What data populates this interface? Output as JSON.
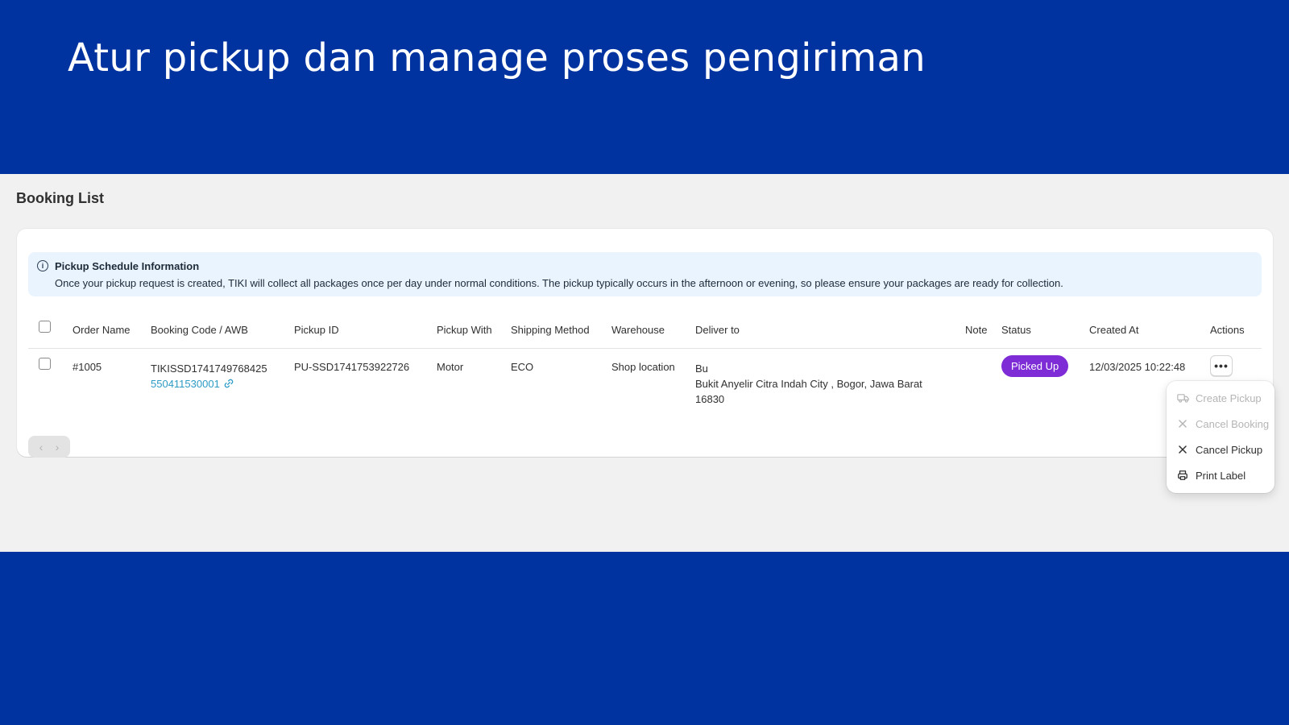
{
  "hero": {
    "title": "Atur pickup dan manage proses pengiriman"
  },
  "page": {
    "title": "Booking List"
  },
  "banner": {
    "icon": "info-icon",
    "title": "Pickup Schedule Information",
    "text": "Once your pickup request is created, TIKI will collect all packages once per day under normal conditions. The pickup typically occurs in the afternoon or evening, so please ensure your packages are ready for collection."
  },
  "table": {
    "headers": {
      "order_name": "Order Name",
      "booking_code": "Booking Code / AWB",
      "pickup_id": "Pickup ID",
      "pickup_with": "Pickup With",
      "shipping_method": "Shipping Method",
      "warehouse": "Warehouse",
      "deliver_to": "Deliver to",
      "note": "Note",
      "status": "Status",
      "created_at": "Created At",
      "actions": "Actions"
    },
    "rows": [
      {
        "order_name": "#1005",
        "booking_code": "TIKISSD1741749768425",
        "awb": "550411530001",
        "pickup_id": "PU-SSD1741753922726",
        "pickup_with": "Motor",
        "shipping_method": "ECO",
        "warehouse": "Shop location",
        "deliver_name": "Bu",
        "deliver_address": "Bukit Anyelir Citra Indah City , Bogor, Jawa Barat",
        "deliver_zip": "16830",
        "note": "",
        "status": "Picked Up",
        "created_at": "12/03/2025 10:22:48",
        "actions_label": "•••"
      }
    ]
  },
  "pagination": {
    "prev": "‹",
    "next": "›"
  },
  "actions_menu": {
    "items": [
      {
        "label": "Create Pickup",
        "icon": "truck-icon",
        "disabled": true
      },
      {
        "label": "Cancel Booking",
        "icon": "close-icon",
        "disabled": true
      },
      {
        "label": "Cancel Pickup",
        "icon": "close-icon",
        "disabled": false
      },
      {
        "label": "Print Label",
        "icon": "printer-icon",
        "disabled": false
      }
    ]
  },
  "colors": {
    "brand_blue": "#0033a0",
    "status_picked_up": "#7e2cd6",
    "link": "#2c9bc4"
  }
}
